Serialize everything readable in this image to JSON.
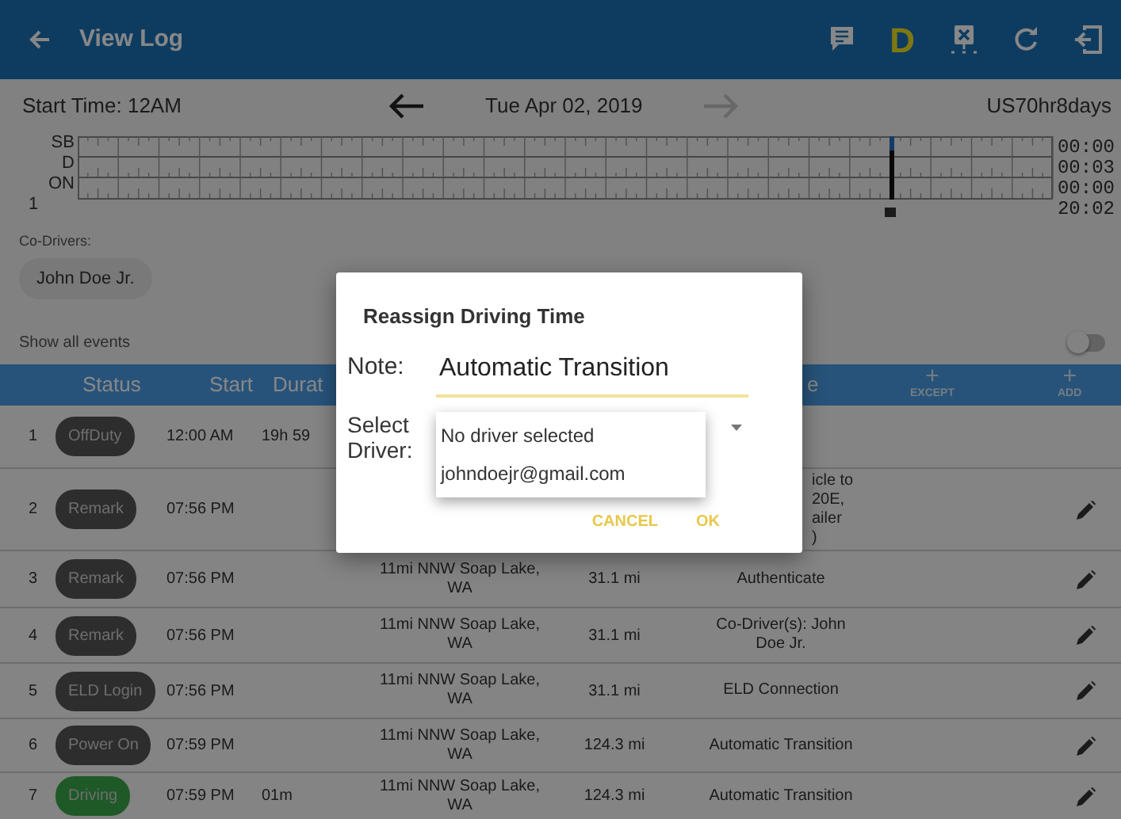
{
  "app_bar": {
    "title": "View Log",
    "driver_letter": "D"
  },
  "log_header": {
    "start_time": "Start Time: 12AM",
    "date": "Tue Apr 02, 2019",
    "next_disabled": true,
    "ruleset": "US70hr8days"
  },
  "graph": {
    "row_labels": [
      "SB",
      "D",
      "ON"
    ],
    "totals": [
      "00:00",
      "00:03",
      "00:00",
      "20:02"
    ],
    "page_label": "1"
  },
  "co_drivers": {
    "label": "Co-Drivers:",
    "names": [
      "John Doe Jr."
    ]
  },
  "show_all_events": {
    "label": "Show all events",
    "on": false
  },
  "table": {
    "columns": [
      "Status",
      "Start",
      "Durat",
      "e"
    ],
    "actions": [
      {
        "icon": "+",
        "label": "EXCEPT"
      },
      {
        "icon": "+",
        "label": "ADD"
      }
    ],
    "rows": [
      {
        "number": "1",
        "status": "OffDuty",
        "kind": "event",
        "start": "12:00 AM",
        "duration": "19h 59"
      },
      {
        "number": "2",
        "status": "Remark",
        "kind": "event",
        "start": "07:56 PM",
        "note": "icle to\n20E,\nailer\n)",
        "editable": true
      },
      {
        "number": "3",
        "status": "Remark",
        "kind": "event",
        "start": "07:56 PM",
        "location": "11mi NNW Soap Lake, WA",
        "distance": "31.1 mi",
        "note": "Authenticate",
        "editable": true
      },
      {
        "number": "4",
        "status": "Remark",
        "kind": "event",
        "start": "07:56 PM",
        "location": "11mi NNW Soap Lake, WA",
        "distance": "31.1 mi",
        "note": "Co-Driver(s): John Doe Jr.",
        "editable": true
      },
      {
        "number": "5",
        "status": "ELD Login",
        "kind": "event",
        "start": "07:56 PM",
        "location": "11mi NNW Soap Lake, WA",
        "distance": "31.1 mi",
        "note": "ELD Connection",
        "editable": true
      },
      {
        "number": "6",
        "status": "Power On",
        "kind": "event",
        "start": "07:59 PM",
        "location": "11mi NNW Soap Lake, WA",
        "distance": "124.3 mi",
        "note": "Automatic Transition",
        "editable": true
      },
      {
        "number": "7",
        "status": "Driving",
        "kind": "driving",
        "start": "07:59 PM",
        "duration": "01m",
        "location": "11mi NNW Soap Lake, WA",
        "distance": "124.3 mi",
        "note": "Automatic Transition",
        "editable": true
      }
    ]
  },
  "dialog": {
    "title": "Reassign Driving Time",
    "note_label": "Note:",
    "note_value": "Automatic Transition",
    "driver_label": "Select Driver:",
    "options": [
      "No driver selected",
      "johndoejr@gmail.com"
    ],
    "buttons": [
      "CANCEL",
      "OK"
    ]
  }
}
